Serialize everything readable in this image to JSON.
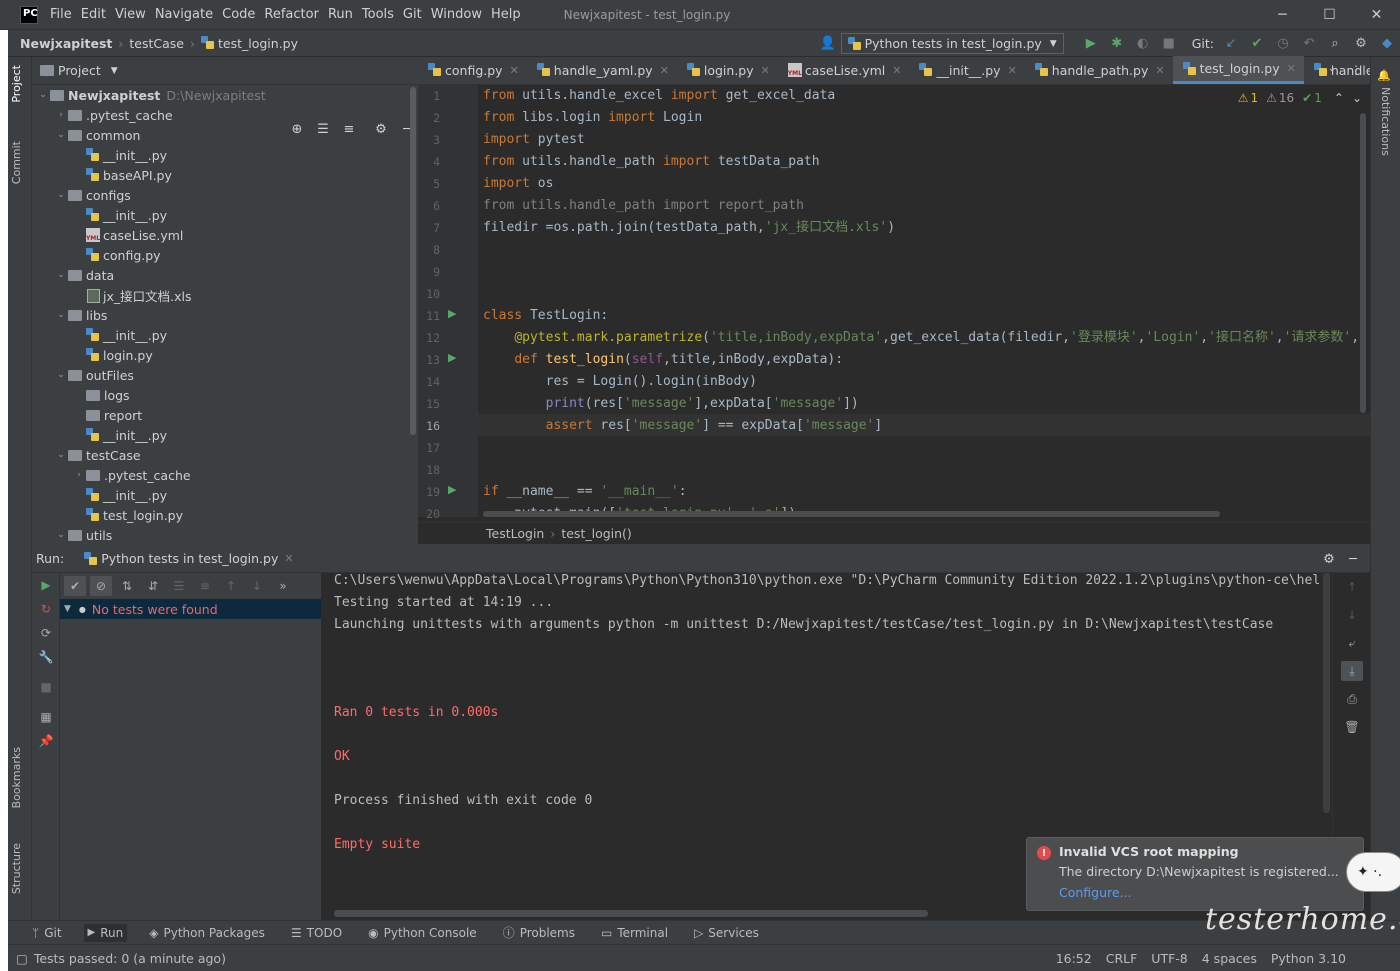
{
  "app": {
    "logo": "PC",
    "window_title": "Newjxapitest - test_login.py"
  },
  "menu": [
    "File",
    "Edit",
    "View",
    "Navigate",
    "Code",
    "Refactor",
    "Run",
    "Tools",
    "Git",
    "Window",
    "Help"
  ],
  "window_controls": {
    "minimize": "─",
    "maximize": "☐",
    "close": "✕"
  },
  "breadcrumb": {
    "project": "Newjxapitest",
    "folder": "testCase",
    "file": "test_login.py"
  },
  "run_config": {
    "label": "Python tests in test_login.py"
  },
  "git_label": "Git:",
  "left_tabs": {
    "project": "Project",
    "commit": "Commit",
    "bookmarks": "Bookmarks",
    "structure": "Structure"
  },
  "right_tabs": {
    "notifications": "Notifications"
  },
  "project_panel": {
    "title": "Project",
    "rows": [
      {
        "label": "Newjxapitest",
        "extra": "D:\\Newjxapitest",
        "type": "folder",
        "depth": 0,
        "arrow": "⌄",
        "bold": true
      },
      {
        "label": ".pytest_cache",
        "type": "folder",
        "depth": 1,
        "arrow": "›"
      },
      {
        "label": "common",
        "type": "folder",
        "depth": 1,
        "arrow": "⌄"
      },
      {
        "label": "__init__.py",
        "type": "py",
        "depth": 2
      },
      {
        "label": "baseAPI.py",
        "type": "py",
        "depth": 2
      },
      {
        "label": "configs",
        "type": "folder",
        "depth": 1,
        "arrow": "⌄"
      },
      {
        "label": "__init__.py",
        "type": "py",
        "depth": 2
      },
      {
        "label": "caseLise.yml",
        "type": "yml",
        "depth": 2
      },
      {
        "label": "config.py",
        "type": "py",
        "depth": 2
      },
      {
        "label": "data",
        "type": "folder",
        "depth": 1,
        "arrow": "⌄"
      },
      {
        "label": "jx_接口文档.xls",
        "type": "xls",
        "depth": 2
      },
      {
        "label": "libs",
        "type": "folder",
        "depth": 1,
        "arrow": "⌄"
      },
      {
        "label": "__init__.py",
        "type": "py",
        "depth": 2
      },
      {
        "label": "login.py",
        "type": "py",
        "depth": 2
      },
      {
        "label": "outFiles",
        "type": "folder",
        "depth": 1,
        "arrow": "⌄"
      },
      {
        "label": "logs",
        "type": "folder",
        "depth": 2
      },
      {
        "label": "report",
        "type": "folder",
        "depth": 2
      },
      {
        "label": "__init__.py",
        "type": "py",
        "depth": 2
      },
      {
        "label": "testCase",
        "type": "folder",
        "depth": 1,
        "arrow": "⌄"
      },
      {
        "label": ".pytest_cache",
        "type": "folder",
        "depth": 2,
        "arrow": "›"
      },
      {
        "label": "__init__.py",
        "type": "py",
        "depth": 2
      },
      {
        "label": "test_login.py",
        "type": "py",
        "depth": 2
      },
      {
        "label": "utils",
        "type": "folder",
        "depth": 1,
        "arrow": "⌄"
      }
    ]
  },
  "editor_tabs": [
    {
      "label": "config.py",
      "active": false
    },
    {
      "label": "handle_yaml.py",
      "active": false
    },
    {
      "label": "login.py",
      "active": false
    },
    {
      "label": "caseLise.yml",
      "active": false
    },
    {
      "label": "__init__.py",
      "active": false
    },
    {
      "label": "handle_path.py",
      "active": false
    },
    {
      "label": "test_login.py",
      "active": true
    },
    {
      "label": "handle_",
      "active": false
    }
  ],
  "inspections": {
    "warnings": "1",
    "weak_warnings": "16",
    "typos": "1"
  },
  "line_numbers": [
    "1",
    "2",
    "3",
    "4",
    "5",
    "6",
    "7",
    "8",
    "9",
    "10",
    "11",
    "12",
    "13",
    "14",
    "15",
    "16",
    "17",
    "18",
    "19",
    "20"
  ],
  "editor_breadcrumb": {
    "class": "TestLogin",
    "method": "test_login()"
  },
  "run_panel": {
    "label": "Run:",
    "tab": "Python tests in test_login.py",
    "tree_item": "No tests were found",
    "console": [
      "C:\\Users\\wenwu\\AppData\\Local\\Programs\\Python\\Python310\\python.exe \"D:\\PyCharm Community Edition 2022.1.2\\plugins\\python-ce\\hel",
      "Testing started at 14:19 ...",
      "Launching unittests with arguments python -m unittest D:/Newjxapitest/testCase/test_login.py in D:\\Newjxapitest\\testCase",
      "Ran 0 tests in 0.000s",
      "OK",
      "Process finished with exit code 0",
      "Empty suite"
    ]
  },
  "notification": {
    "title": "Invalid VCS root mapping",
    "body": "The directory D:\\Newjxapitest is registered...",
    "link": "Configure..."
  },
  "bottom_tools": [
    "Git",
    "Run",
    "Python Packages",
    "TODO",
    "Python Console",
    "Problems",
    "Terminal",
    "Services"
  ],
  "status": {
    "message": "Tests passed: 0 (a minute ago)",
    "position": "16:52",
    "line_sep": "CRLF",
    "encoding": "UTF-8",
    "indent": "4 spaces",
    "interpreter": "Python 3.10"
  },
  "watermark": "testerhome.com"
}
